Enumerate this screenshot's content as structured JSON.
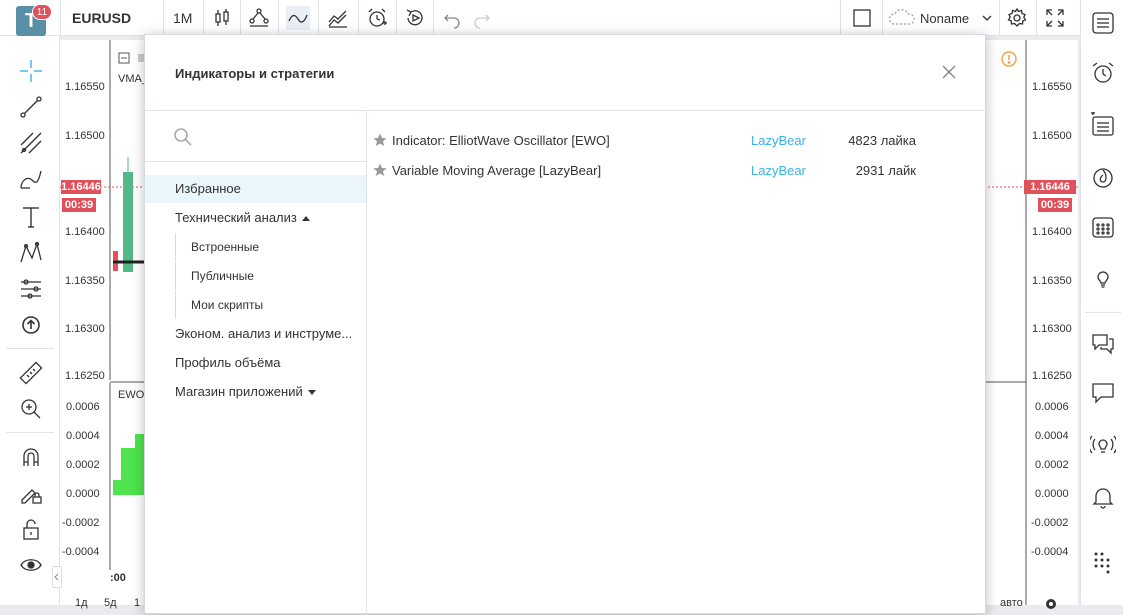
{
  "app": {
    "logo_letter": "T",
    "notifications_count": "11"
  },
  "toolbar": {
    "symbol": "EURUSD",
    "interval": "1M",
    "layout_name": "Noname"
  },
  "chart": {
    "price_ticks": [
      "1.16550",
      "1.16500",
      "1.16400",
      "1.16350",
      "1.16300",
      "1.16250"
    ],
    "current_price": "1.16446",
    "countdown": "00:39",
    "main_pane_label": "VMA_",
    "osc_pane_label": "EWO_",
    "osc_ticks": [
      "0.0006",
      "0.0004",
      "0.0002",
      "0.0000",
      "-0.0002",
      "-0.0004"
    ],
    "time_label": ":00",
    "bottom_left_labels": [
      "1д",
      "5д",
      "1"
    ],
    "bottom_right_label": "авто"
  },
  "modal": {
    "title": "Индикаторы и стратегии",
    "search_placeholder": "",
    "categories": {
      "favorites": "Избранное",
      "technical": "Технический анализ",
      "builtin": "Встроенные",
      "public": "Публичные",
      "my_scripts": "Мои скрипты",
      "economic": "Эконом. анализ и инструме...",
      "volume_profile": "Профиль объёма",
      "store": "Магазин приложений"
    },
    "results": [
      {
        "name": "Indicator: ElliotWave Oscillator [EWO]",
        "author": "LazyBear",
        "likes": "4823 лайка"
      },
      {
        "name": "Variable Moving Average [LazyBear]",
        "author": "LazyBear",
        "likes": "2931 лайк"
      }
    ]
  },
  "colors": {
    "accent": "#3bb3e4",
    "price_tag": "#e0515b",
    "candle_up": "#53b987",
    "candle_down": "#eb4d5c",
    "osc_bar": "#4ee44e"
  }
}
